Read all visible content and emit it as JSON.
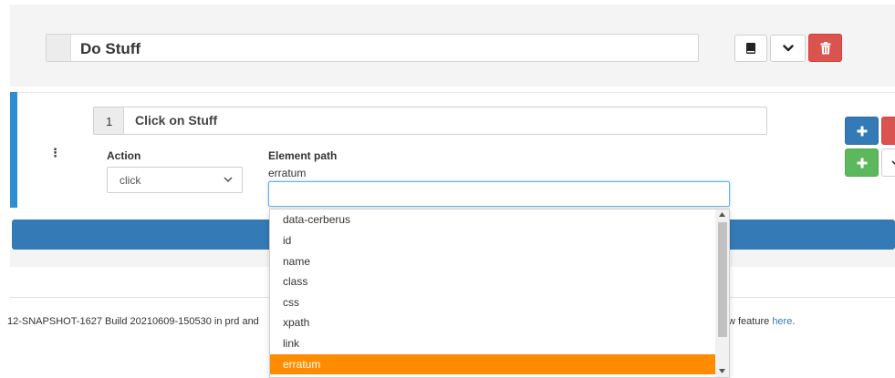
{
  "test": {
    "title": "Do Stuff"
  },
  "step": {
    "number": "1",
    "title": "Click on Stuff",
    "menu_glyph": "⋮",
    "action_label": "Action",
    "action_value": "click",
    "element_path_label": "Element path",
    "element_path_value": "erratum",
    "element_input_value": ""
  },
  "dropdown": {
    "options": [
      "data-cerberus",
      "id",
      "name",
      "class",
      "css",
      "xpath",
      "link",
      "erratum"
    ],
    "selected": "erratum"
  },
  "footer": {
    "build_text": "12-SNAPSHOT-1627 Build 20210609-150530 in prd and",
    "feature_text": "w feature ",
    "feature_link": "here",
    "feature_suffix": "."
  },
  "colors": {
    "danger": "#d9534f",
    "primary": "#337ab7",
    "success": "#5cb85c",
    "highlight": "#ff8c00",
    "accent": "#2e8ed4"
  }
}
